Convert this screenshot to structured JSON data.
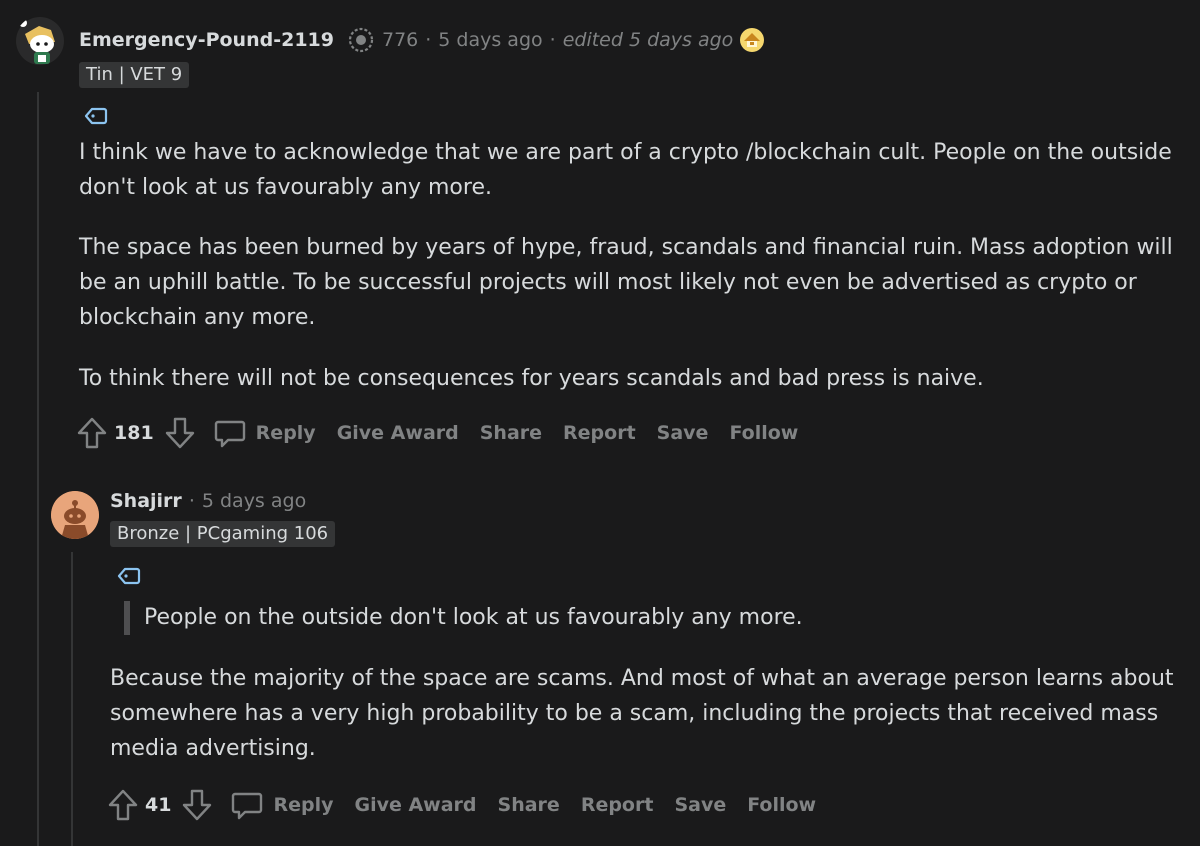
{
  "comments": [
    {
      "username": "Emergency-Pound-2119",
      "karma": "776",
      "separator": "·",
      "time": "5 days ago",
      "edited": "edited 5 days ago",
      "flair": "Tin | VET 9",
      "paragraphs": [
        "I think we have to acknowledge that we are part of a crypto /blockchain cult. People on the outside don't look at us favourably any more.",
        "The space has been burned by years of hype, fraud, scandals and financial ruin. Mass adoption will be an uphill battle. To be successful projects will most likely not even be advertised as crypto or blockchain any more.",
        "To think there will not be consequences for years scandals and bad press is naive."
      ],
      "score": "181",
      "actions": [
        "Reply",
        "Give Award",
        "Share",
        "Report",
        "Save",
        "Follow"
      ]
    },
    {
      "username": "Shajirr",
      "separator": "·",
      "time": "5 days ago",
      "flair": "Bronze | PCgaming 106",
      "quote": "People on the outside don't look at us favourably any more.",
      "paragraphs": [
        "Because the majority of the space are scams. And most of what an average person learns about somewhere has a very high probability to be a scam, including the projects that received mass media advertising."
      ],
      "score": "41",
      "actions": [
        "Reply",
        "Give Award",
        "Share",
        "Report",
        "Save",
        "Follow"
      ]
    }
  ],
  "icons": {
    "upvote": "arrow-up-icon",
    "downvote": "arrow-down-icon",
    "reply": "speech-bubble-icon",
    "tag": "tag-icon",
    "karma": "karma-badge-icon",
    "award": "award-icon"
  },
  "colors": {
    "background": "#1a1a1b",
    "text": "#d7dadc",
    "muted": "#818384",
    "flair_bg": "#343536",
    "tag_icon": "#8cc4f0"
  }
}
